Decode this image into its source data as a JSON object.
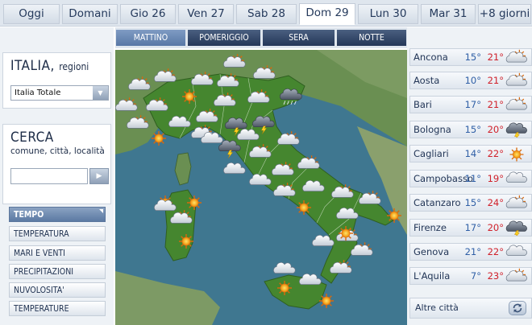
{
  "day_tabs": [
    {
      "label": "Oggi",
      "active": false
    },
    {
      "label": "Domani",
      "active": false
    },
    {
      "label": "Gio 26",
      "active": false
    },
    {
      "label": "Ven 27",
      "active": false
    },
    {
      "label": "Sab 28",
      "active": false
    },
    {
      "label": "Dom 29",
      "active": true
    },
    {
      "label": "Lun 30",
      "active": false
    },
    {
      "label": "Mar 31",
      "active": false
    },
    {
      "label": "+8 giorni",
      "active": false
    }
  ],
  "periods": [
    {
      "label": "MATTINO",
      "active": true
    },
    {
      "label": "POMERIGGIO",
      "active": false
    },
    {
      "label": "SERA",
      "active": false
    },
    {
      "label": "NOTTE",
      "active": false
    }
  ],
  "italia": {
    "title": "ITALIA,",
    "subtitle": "regioni",
    "select_value": "Italia Totale"
  },
  "cerca": {
    "title": "CERCA",
    "subtitle": "comune, città, località",
    "placeholder": ""
  },
  "menu": [
    {
      "label": "TEMPO",
      "active": true
    },
    {
      "label": "TEMPERATURA",
      "active": false
    },
    {
      "label": "MARI E VENTI",
      "active": false
    },
    {
      "label": "PRECIPITAZIONI",
      "active": false
    },
    {
      "label": "NUVOLOSITA'",
      "active": false
    },
    {
      "label": "TEMPERATURE",
      "active": false
    }
  ],
  "cities": [
    {
      "name": "Ancona",
      "tmin": "15°",
      "tmax": "21°",
      "icon": "partly-cloudy-icon"
    },
    {
      "name": "Aosta",
      "tmin": "10°",
      "tmax": "21°",
      "icon": "partly-cloudy-icon"
    },
    {
      "name": "Bari",
      "tmin": "17°",
      "tmax": "21°",
      "icon": "partly-cloudy-icon"
    },
    {
      "name": "Bologna",
      "tmin": "15°",
      "tmax": "20°",
      "icon": "thunderstorm-icon"
    },
    {
      "name": "Cagliari",
      "tmin": "14°",
      "tmax": "22°",
      "icon": "sun-icon"
    },
    {
      "name": "Campobasso",
      "tmin": "11°",
      "tmax": "19°",
      "icon": "cloudy-icon"
    },
    {
      "name": "Catanzaro",
      "tmin": "15°",
      "tmax": "24°",
      "icon": "partly-cloudy-icon"
    },
    {
      "name": "Firenze",
      "tmin": "17°",
      "tmax": "20°",
      "icon": "thunderstorm-icon"
    },
    {
      "name": "Genova",
      "tmin": "21°",
      "tmax": "22°",
      "icon": "cloudy-icon"
    },
    {
      "name": "L'Aquila",
      "tmin": "7°",
      "tmax": "23°",
      "icon": "partly-cloudy-icon"
    }
  ],
  "altre_citta": "Altre città",
  "colors": {
    "sea": "#3f7790",
    "land": "#5b8a47",
    "italy": "#45862f",
    "accent": "#5878a6"
  }
}
